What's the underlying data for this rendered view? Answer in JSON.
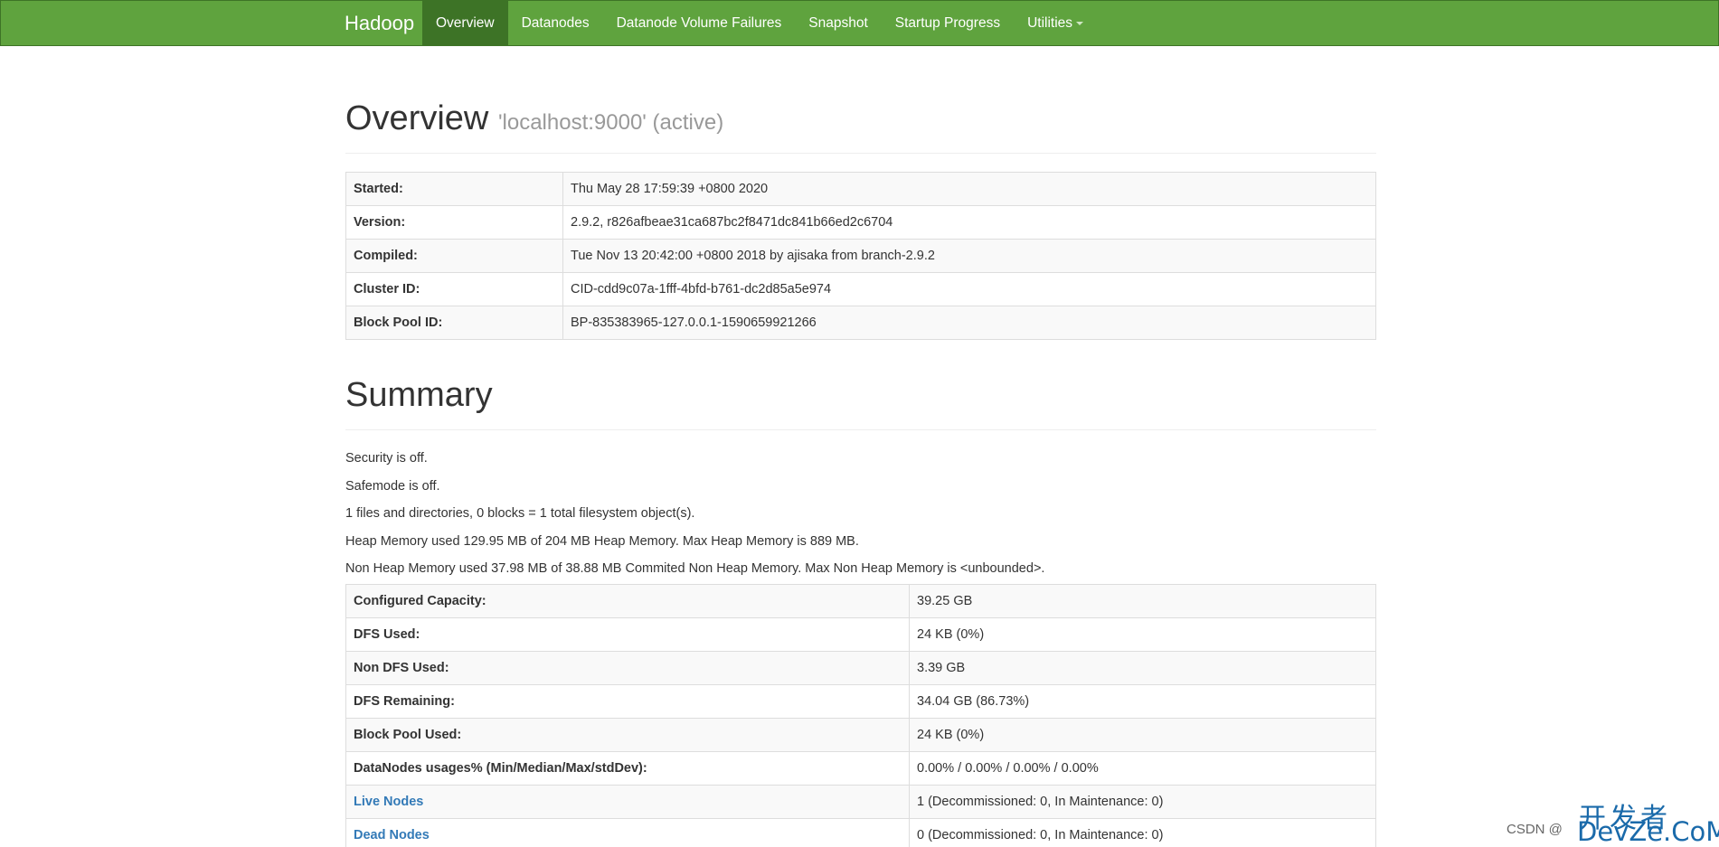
{
  "navbar": {
    "brand": "Hadoop",
    "items": [
      {
        "label": "Overview",
        "active": true
      },
      {
        "label": "Datanodes"
      },
      {
        "label": "Datanode Volume Failures"
      },
      {
        "label": "Snapshot"
      },
      {
        "label": "Startup Progress"
      },
      {
        "label": "Utilities"
      }
    ]
  },
  "overview": {
    "title": "Overview",
    "subtitle": "'localhost:9000' (active)",
    "rows": [
      {
        "key": "Started:",
        "value": "Thu May 28 17:59:39 +0800 2020"
      },
      {
        "key": "Version:",
        "value": "2.9.2, r826afbeae31ca687bc2f8471dc841b66ed2c6704"
      },
      {
        "key": "Compiled:",
        "value": "Tue Nov 13 20:42:00 +0800 2018 by ajisaka from branch-2.9.2"
      },
      {
        "key": "Cluster ID:",
        "value": "CID-cdd9c07a-1fff-4bfd-b761-dc2d85a5e974"
      },
      {
        "key": "Block Pool ID:",
        "value": "BP-835383965-127.0.0.1-1590659921266"
      }
    ]
  },
  "summary": {
    "title": "Summary",
    "lines": [
      "Security is off.",
      "Safemode is off.",
      "1 files and directories, 0 blocks = 1 total filesystem object(s).",
      "Heap Memory used 129.95 MB of 204 MB Heap Memory. Max Heap Memory is 889 MB.",
      "Non Heap Memory used 37.98 MB of 38.88 MB Commited Non Heap Memory. Max Non Heap Memory is <unbounded>."
    ],
    "rows": [
      {
        "key": "Configured Capacity:",
        "value": "39.25 GB"
      },
      {
        "key": "DFS Used:",
        "value": "24 KB (0%)"
      },
      {
        "key": "Non DFS Used:",
        "value": "3.39 GB"
      },
      {
        "key": "DFS Remaining:",
        "value": "34.04 GB (86.73%)"
      },
      {
        "key": "Block Pool Used:",
        "value": "24 KB (0%)"
      },
      {
        "key": "DataNodes usages% (Min/Median/Max/stdDev):",
        "value": "0.00% / 0.00% / 0.00% / 0.00%"
      },
      {
        "key": "Live Nodes",
        "value": "1 (Decommissioned: 0, In Maintenance: 0)"
      },
      {
        "key": "Dead Nodes",
        "value": "0 (Decommissioned: 0, In Maintenance: 0)"
      }
    ]
  },
  "watermark": {
    "top": "开发者",
    "csdn": "CSDN @",
    "bottom": "DevZe.CoM"
  }
}
